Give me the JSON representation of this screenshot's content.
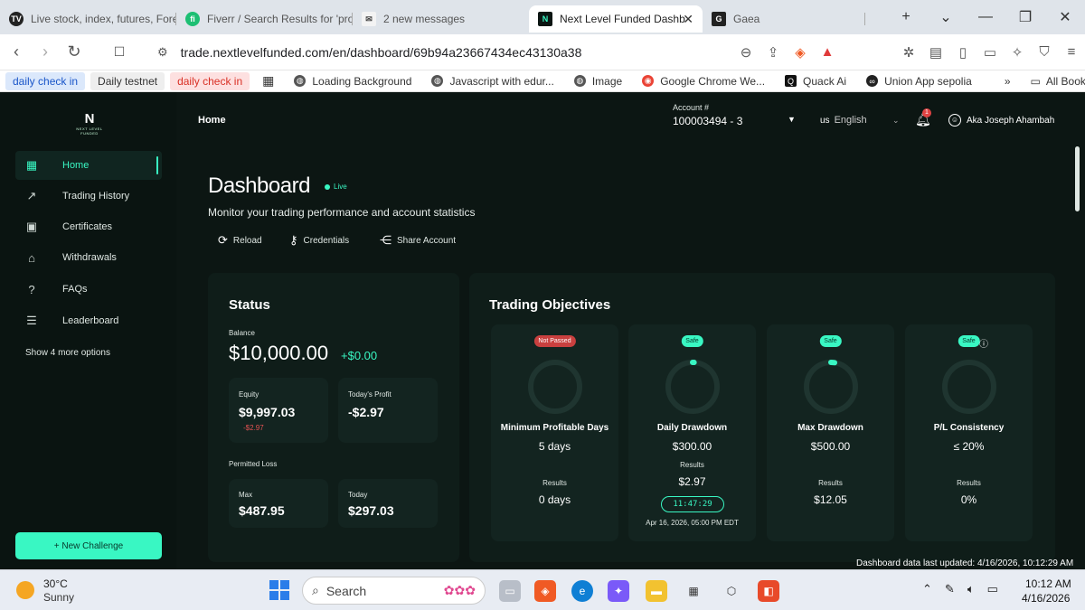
{
  "browser": {
    "tabs": [
      {
        "label": "Live stock, index, futures, Fore",
        "icon": "tradingview-icon"
      },
      {
        "label": "Fiverr / Search Results for 'pro",
        "icon": "fiverr-icon"
      },
      {
        "label": "2 new messages",
        "icon": "messages-icon"
      },
      {
        "label": "Next Level Funded Dashb",
        "icon": "nlf-icon"
      },
      {
        "label": "Gaea",
        "icon": "gaea-icon"
      }
    ],
    "url": "trade.nextlevelfunded.com/en/dashboard/69b94a23667434ec43130a38",
    "bookmarks": [
      {
        "label": "daily check in",
        "style": "blue"
      },
      {
        "label": "Daily testnet",
        "style": "grey"
      },
      {
        "label": "daily check in",
        "style": "red"
      },
      {
        "label": "Loading Background",
        "style": "plain"
      },
      {
        "label": "Javascript with edur...",
        "style": "plain"
      },
      {
        "label": "Image",
        "style": "plain"
      },
      {
        "label": "Google Chrome We...",
        "style": "plain"
      },
      {
        "label": "Quack Ai",
        "style": "plain"
      },
      {
        "label": "Union App sepolia",
        "style": "plain"
      },
      {
        "label": "All Bookmarks",
        "style": "plain"
      }
    ]
  },
  "logo": {
    "mark": "N",
    "line1": "NEXT LEVEL",
    "line2": "FUNDED"
  },
  "sidebar": {
    "items": [
      {
        "label": "Home",
        "icon": "grid-icon",
        "active": true
      },
      {
        "label": "Trading History",
        "icon": "trend-icon"
      },
      {
        "label": "Certificates",
        "icon": "certificate-icon"
      },
      {
        "label": "Withdrawals",
        "icon": "bank-icon"
      },
      {
        "label": "FAQs",
        "icon": "question-icon"
      },
      {
        "label": "Leaderboard",
        "icon": "list-icon"
      }
    ],
    "show_more": "Show 4 more options",
    "new_challenge": "+ New Challenge"
  },
  "header": {
    "breadcrumb": "Home",
    "account_label": "Account #",
    "account_number": "100003494 - 3",
    "lang_flag": "us",
    "language": "English",
    "notifications": "1",
    "user": "Aka Joseph Ahambah"
  },
  "dashboard": {
    "title": "Dashboard",
    "live": "Live",
    "subtitle": "Monitor your trading performance and account statistics",
    "actions": [
      "Reload",
      "Credentials",
      "Share Account"
    ]
  },
  "status": {
    "title": "Status",
    "balance_label": "Balance",
    "balance": "$10,000.00",
    "balance_change": "+$0.00",
    "equity_label": "Equity",
    "equity": "$9,997.03",
    "equity_change": "-$2.97",
    "today_profit_label": "Today's Profit",
    "today_profit": "-$2.97",
    "permitted_loss_label": "Permitted Loss",
    "max_label": "Max",
    "max": "$487.95",
    "today_label": "Today",
    "today": "$297.03"
  },
  "objectives": {
    "title": "Trading Objectives",
    "items": [
      {
        "badge": "Not Passed",
        "badge_color": "red",
        "label": "Minimum Profitable Days",
        "target": "5 days",
        "results_label": "Results",
        "result": "0 days",
        "progress": 0
      },
      {
        "badge": "Safe",
        "badge_color": "green",
        "label": "Daily Drawdown",
        "target": "$300.00",
        "results_label": "Results",
        "result": "$2.97",
        "timer": "11:47:29",
        "deadline": "Apr 16, 2026, 05:00 PM EDT",
        "progress": 0.01
      },
      {
        "badge": "Safe",
        "badge_color": "green",
        "label": "Max Drawdown",
        "target": "$500.00",
        "results_label": "Results",
        "result": "$12.05",
        "progress": 0.024
      },
      {
        "badge": "Safe",
        "badge_color": "green",
        "label": "P/L Consistency",
        "target": "≤ 20%",
        "results_label": "Results",
        "result": "0%",
        "progress": 0
      }
    ]
  },
  "updated": "Dashboard data last updated: 4/16/2026, 10:12:29 AM",
  "taskbar": {
    "temp": "30°C",
    "condition": "Sunny",
    "search": "Search",
    "time": "10:12 AM",
    "date": "4/16/2026"
  },
  "colors": {
    "accent": "#39f7c3",
    "danger": "#c9403f",
    "bg": "#0c1613",
    "card": "#0f1d19"
  }
}
